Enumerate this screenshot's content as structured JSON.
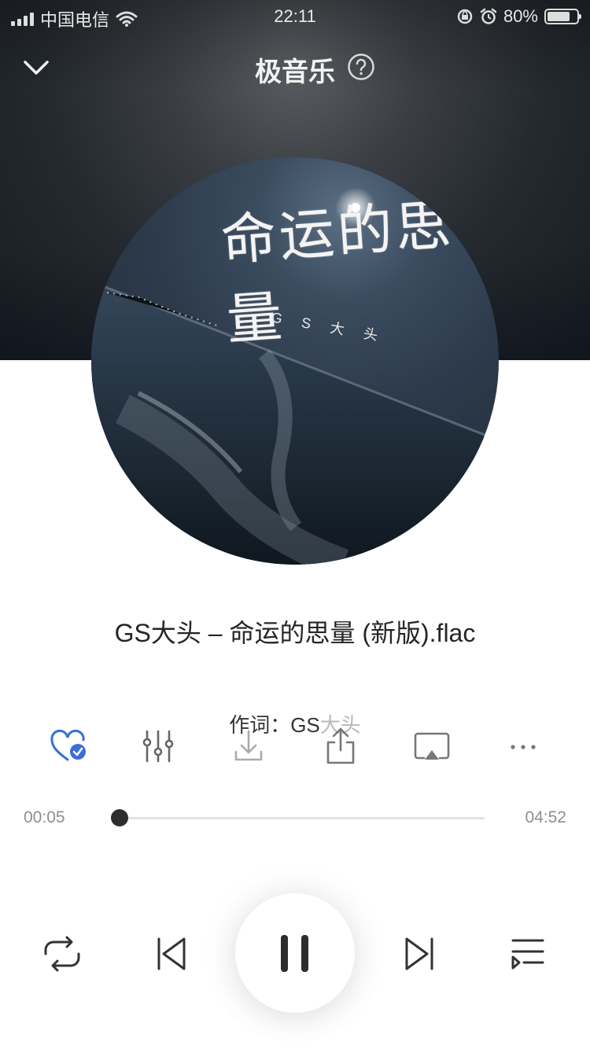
{
  "status_bar": {
    "carrier": "中国电信",
    "time": "22:11",
    "battery_percent": "80%",
    "battery_level": 0.8
  },
  "nav": {
    "title": "极音乐",
    "back_icon": "chevron-down-icon",
    "help_icon": "question-circle-icon"
  },
  "album_art": {
    "title": "命运的思量",
    "artist": "G S 大 头"
  },
  "song": {
    "display_name": "GS大头 – 命运的思量 (新版).flac"
  },
  "lyric": {
    "prefix": "作词：GS",
    "faded": "大头"
  },
  "actions": [
    {
      "name": "favorite",
      "icon": "heart-check-icon",
      "color": "#3a6ed8"
    },
    {
      "name": "equalizer",
      "icon": "sliders-icon"
    },
    {
      "name": "download",
      "icon": "download-icon"
    },
    {
      "name": "share",
      "icon": "share-icon"
    },
    {
      "name": "airplay",
      "icon": "airplay-icon"
    },
    {
      "name": "more",
      "icon": "more-icon"
    }
  ],
  "progress": {
    "current": "00:05",
    "total": "04:52",
    "fraction": 0.017
  },
  "controls": {
    "repeat_icon": "repeat-icon",
    "prev_icon": "previous-icon",
    "pause_icon": "pause-icon",
    "next_icon": "next-icon",
    "playlist_icon": "playlist-icon"
  }
}
